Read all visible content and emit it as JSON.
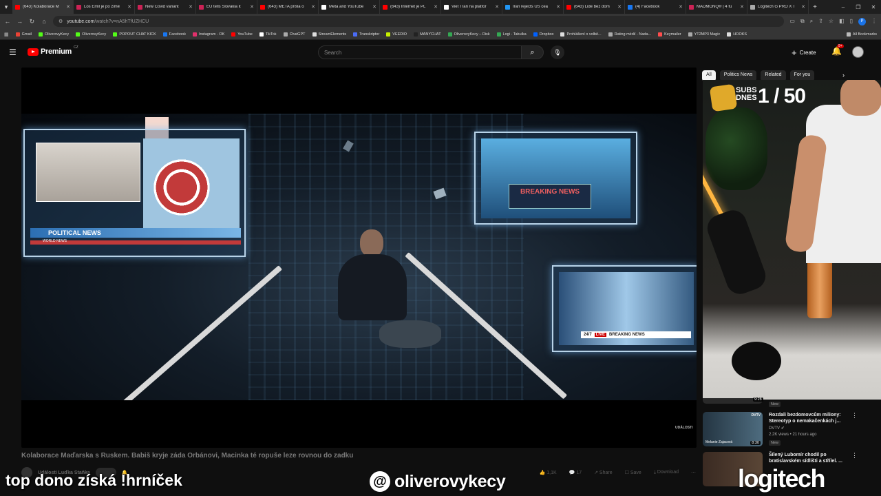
{
  "browser": {
    "tabs": [
      {
        "title": "(643) Kolaborace M",
        "color": "#ff0000",
        "active": true
      },
      {
        "title": "Los Emil je po zimě",
        "color": "#cc2255"
      },
      {
        "title": "New Covid variant",
        "color": "#cc2255"
      },
      {
        "title": "EU tells Slovakia it",
        "color": "#cc2255"
      },
      {
        "title": "(643) META prišla o",
        "color": "#ff0000"
      },
      {
        "title": "Meta and YouTube",
        "color": "#ffffff"
      },
      {
        "title": "(643) Internet je PL",
        "color": "#ff0000"
      },
      {
        "title": "Viet Tran na platfor",
        "color": "#ffffff"
      },
      {
        "title": "Iran rejects US cea",
        "color": "#2196f3"
      },
      {
        "title": "(643) Lidé bez dom",
        "color": "#ff0000"
      },
      {
        "title": "(4) Facebook",
        "color": "#1877f2"
      },
      {
        "title": "MADMONQ® | 4 fu",
        "color": "#cc2255"
      },
      {
        "title": "Logitech G PRO X T",
        "color": "#aaaaaa"
      }
    ],
    "new_tab": "+",
    "window_controls": {
      "minimize": "–",
      "restore": "❐",
      "close": "✕"
    },
    "url": "youtube.com/watch?v=nA5hTfUZHCU",
    "url_host": "youtube.com",
    "url_path": "/watch?v=nA5hTfUZHCU",
    "profile_initial": "P",
    "bookmarks": [
      {
        "label": "Gmail",
        "color": "#ea4335"
      },
      {
        "label": "OliverovyKecy",
        "color": "#53fc18"
      },
      {
        "label": "OliverovyKecy",
        "color": "#53fc18"
      },
      {
        "label": "POPOUT CHAT KICK",
        "color": "#53fc18"
      },
      {
        "label": "Facebook",
        "color": "#1877f2"
      },
      {
        "label": "Instagram - OK",
        "color": "#e1306c"
      },
      {
        "label": "YouTube",
        "color": "#ff0000"
      },
      {
        "label": "TikTok",
        "color": "#ffffff"
      },
      {
        "label": "ChatGPT",
        "color": "#aaaaaa"
      },
      {
        "label": "StreamElements",
        "color": "#dddddd"
      },
      {
        "label": "Transkriptor",
        "color": "#4a6cf7"
      },
      {
        "label": "VEEDIO",
        "color": "#c7f000"
      },
      {
        "label": "MANYCHAT",
        "color": "#222222"
      },
      {
        "label": "OliverovyKecy – Disk",
        "color": "#34a853"
      },
      {
        "label": "Logi - Tabulka",
        "color": "#34a853"
      },
      {
        "label": "Dropbox",
        "color": "#0061ff"
      },
      {
        "label": "Prohlášení o volbě...",
        "color": "#dddddd"
      },
      {
        "label": "Rating médií - Nada...",
        "color": "#aaaaaa"
      },
      {
        "label": "Keymailer",
        "color": "#ff4d4d"
      },
      {
        "label": "YT2MP3 Magic",
        "color": "#aaaaaa"
      },
      {
        "label": "HOOKS",
        "color": "#dddddd"
      }
    ],
    "all_bookmarks": "All Bookmarks"
  },
  "youtube": {
    "logo": "Premium",
    "country": "CZ",
    "search_placeholder": "Search",
    "create_label": "Create",
    "notification_count": "9+",
    "video": {
      "title": "Kolaborace Maďarska s Ruskem. Babiš kryje záda Orbánovi, Macinka té ropuše leze rovnou do zadku",
      "channel": "Události Luďka Staňka",
      "likes": "1,1K",
      "comments": "17",
      "share": "Share",
      "save": "Save",
      "download": "Download",
      "more": "⋯",
      "frame_text": {
        "political_news": "POLITICAL NEWS",
        "world_news": "WORLD NEWS",
        "breaking_news": "BREAKING NEWS",
        "live_247": "24/7",
        "live": "LIVE",
        "breaking_ticker": "BREAKING NEWS",
        "watermark": "UDÁLOSTI"
      }
    },
    "chips": [
      {
        "label": "All",
        "active": true
      },
      {
        "label": "Politics News"
      },
      {
        "label": "Related"
      },
      {
        "label": "For you"
      }
    ],
    "chip_next": "›",
    "webcam": {
      "subs_label": "SUBS DNES",
      "count": "1 / 50"
    },
    "partial_item": {
      "duration": "9:28",
      "badge": "New"
    },
    "sidebar_items": [
      {
        "title": "Rozdali bezdomovcům miliony: Stereotyp o nemakačenkách j...",
        "channel": "DVTV",
        "meta": "2.2K views • 21 hours ago",
        "badge": "New",
        "duration": "8:30",
        "thumb_label": "Melanie Zajacová",
        "thumb_brand": "DVTV"
      },
      {
        "title": "Šílený Lubomír chodil po bratislavském sídlišti a střílel. ...",
        "channel": "",
        "meta": "",
        "badge": "",
        "duration": "",
        "thumb_label": "",
        "thumb_brand": ""
      }
    ]
  },
  "overlays": {
    "left_text": "top dono získá !hrníček",
    "handle": "oliverovykecy",
    "sponsor": "logitech"
  }
}
